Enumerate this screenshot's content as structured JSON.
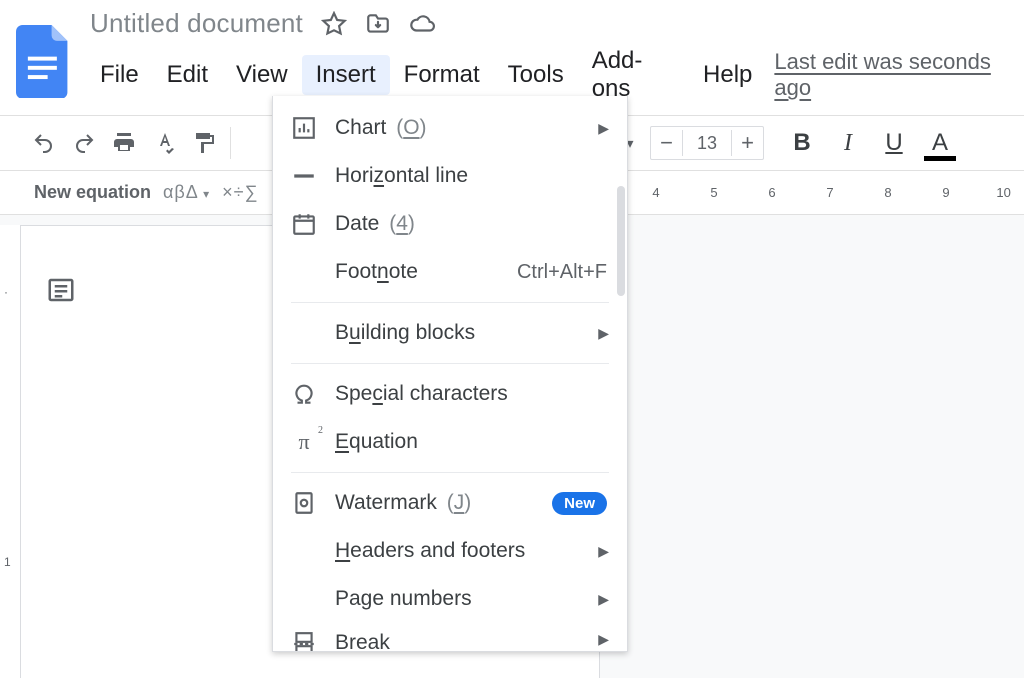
{
  "title": "Untitled document",
  "menubar": {
    "file": "File",
    "edit": "Edit",
    "view": "View",
    "insert": "Insert",
    "format": "Format",
    "tools": "Tools",
    "addons": "Add-ons",
    "help": "Help",
    "last_edit": "Last edit was seconds ago"
  },
  "toolbar": {
    "font_size": "13"
  },
  "eqbar": {
    "new_equation": "New equation",
    "greek": "αβΔ",
    "ops": "×÷∑"
  },
  "insert_menu": {
    "chart": "Chart",
    "chart_hint": "(",
    "chart_hint_u": "O",
    "chart_hint2": ")",
    "hline": "Hori",
    "hline_u": "z",
    "hline2": "ontal line",
    "date": "Date",
    "date_hint": "(",
    "date_hint_u": "4",
    "date_hint2": ")",
    "footnote": "Foot",
    "footnote_u": "n",
    "footnote2": "ote",
    "footnote_sc": "Ctrl+Alt+F",
    "building": "B",
    "building_u": "u",
    "building2": "ilding blocks",
    "special": "Spe",
    "special_u": "c",
    "special2": "ial characters",
    "equation": "",
    "equation_u": "E",
    "equation2": "quation",
    "watermark": "Watermark",
    "watermark_hint": "(",
    "watermark_hint_u": "J",
    "watermark_hint2": ")",
    "new_badge": "New",
    "headers": "",
    "headers_u": "H",
    "headers2": "eaders and footers",
    "pagenums": "Page numbers",
    "break": "Break"
  },
  "ruler_right": [
    "4",
    "5",
    "6",
    "7",
    "8",
    "9",
    "10"
  ]
}
